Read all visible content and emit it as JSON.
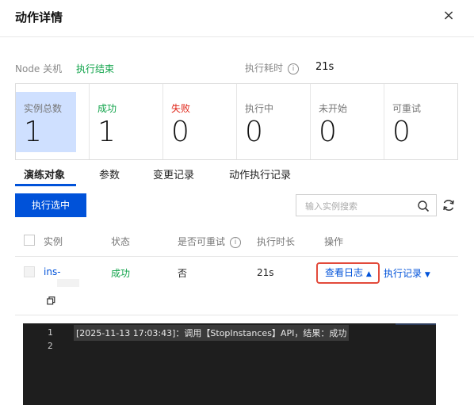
{
  "dialog": {
    "title": "动作详情",
    "close_glyph": "×"
  },
  "summary": {
    "node_label": "Node 关机",
    "node_status": "执行结束",
    "duration_label": "执行耗时",
    "duration_value": "21s"
  },
  "stats": [
    {
      "label": "实例总数",
      "value": "1"
    },
    {
      "label": "成功",
      "value": "1"
    },
    {
      "label": "失败",
      "value": "0"
    },
    {
      "label": "执行中",
      "value": "0"
    },
    {
      "label": "未开始",
      "value": "0"
    },
    {
      "label": "可重试",
      "value": "0"
    }
  ],
  "tabs": [
    "演练对象",
    "参数",
    "变更记录",
    "动作执行记录"
  ],
  "toolbar": {
    "run_selected": "执行选中",
    "search_placeholder": "输入实例搜索"
  },
  "table": {
    "headers": [
      "实例",
      "状态",
      "是否可重试",
      "执行时长",
      "操作"
    ],
    "rows": [
      {
        "instance": "ins-",
        "status": "成功",
        "retryable": "否",
        "duration": "21s",
        "action_log": "查看日志",
        "action_history": "执行记录"
      }
    ]
  },
  "log": {
    "line_numbers": [
      "1",
      "2"
    ],
    "lines": [
      "[2025-11-13 17:03:43]：调用【StopInstances】API，结果：成功"
    ]
  },
  "colors": {
    "accent": "#0052d9",
    "success": "#10a34a",
    "danger": "#e0271a",
    "highlight": "#cfe0ff",
    "log_border": "#e24a3b"
  },
  "icons": [
    "close-icon",
    "info-icon",
    "search-icon",
    "refresh-icon",
    "copy-icon",
    "caret-up-icon",
    "caret-down-icon"
  ]
}
